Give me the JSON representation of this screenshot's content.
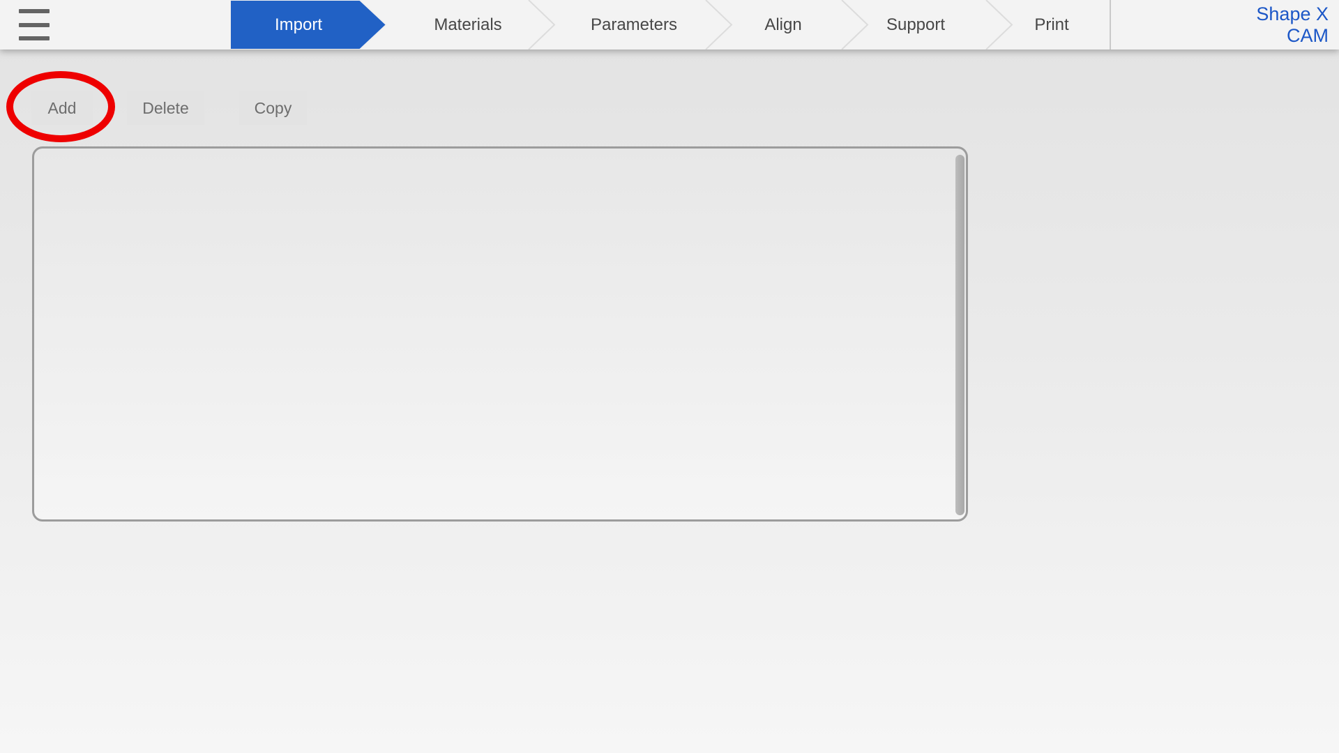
{
  "header": {
    "menu_icon": "hamburger-icon",
    "tabs": [
      {
        "label": "Import",
        "active": true
      },
      {
        "label": "Materials",
        "active": false
      },
      {
        "label": "Parameters",
        "active": false
      },
      {
        "label": "Align",
        "active": false
      },
      {
        "label": "Support",
        "active": false
      },
      {
        "label": "Print",
        "active": false
      }
    ],
    "logo": {
      "line1": "Shape X",
      "line2": "CAM"
    }
  },
  "toolbar": {
    "add_label": "Add",
    "delete_label": "Delete",
    "copy_label": "Copy"
  },
  "annotation": {
    "shape": "ellipse-highlight",
    "target": "add-button",
    "color": "#ee0000"
  },
  "model_list": {
    "items": [],
    "scrollbar_visible": true
  },
  "colors": {
    "accent_blue": "#2161c5",
    "header_bg": "#f3f3f3",
    "panel_border": "#9c9c9c",
    "inactive_tab_text": "#474747",
    "chevron_line": "#dcdcdc"
  }
}
